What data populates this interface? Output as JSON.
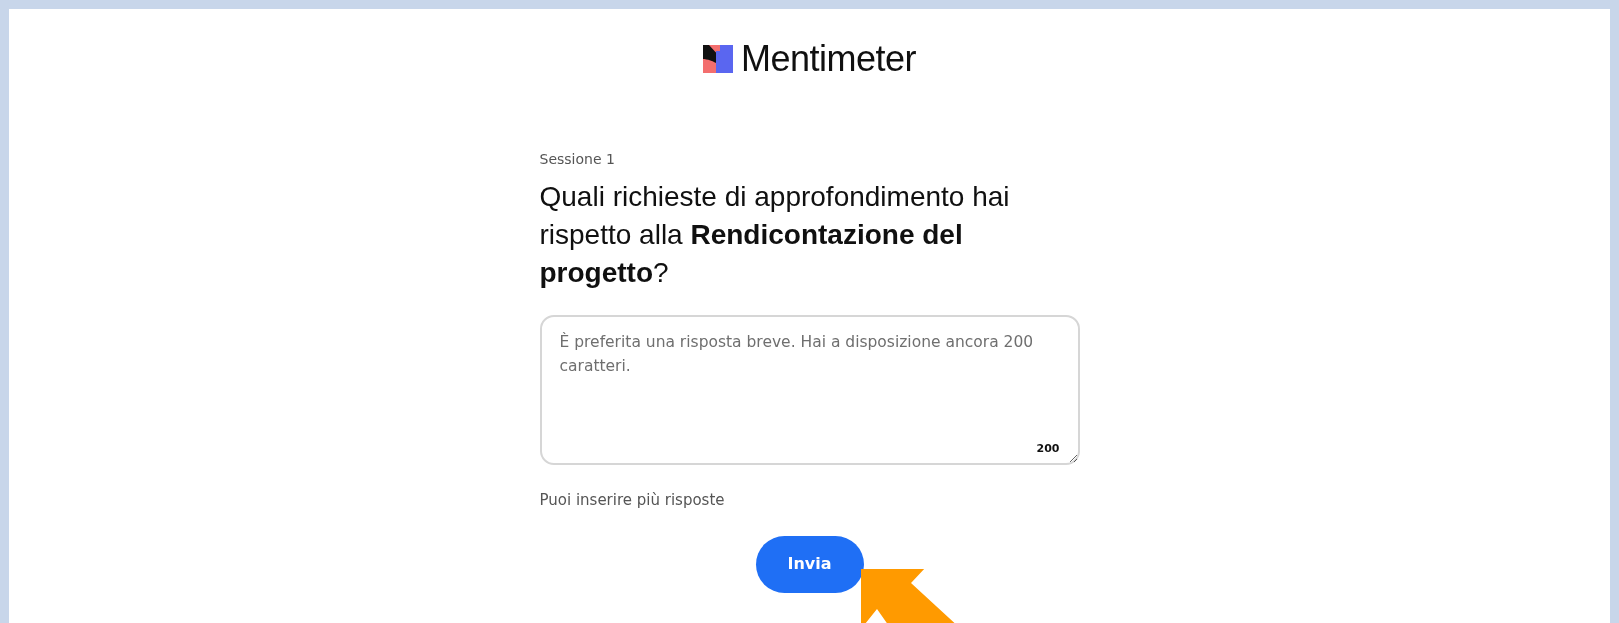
{
  "logo": {
    "text": "Mentimeter"
  },
  "session": "Sessione 1",
  "question": "Quali richieste di approfondimento hai rispetto alla **Rendicontazione del progetto**?",
  "answer": {
    "placeholder": "È preferita una risposta breve. Hai a disposizione ancora 200 caratteri.",
    "counter": "200"
  },
  "hint": "Puoi inserire più risposte",
  "submit": {
    "label": "Invia"
  }
}
